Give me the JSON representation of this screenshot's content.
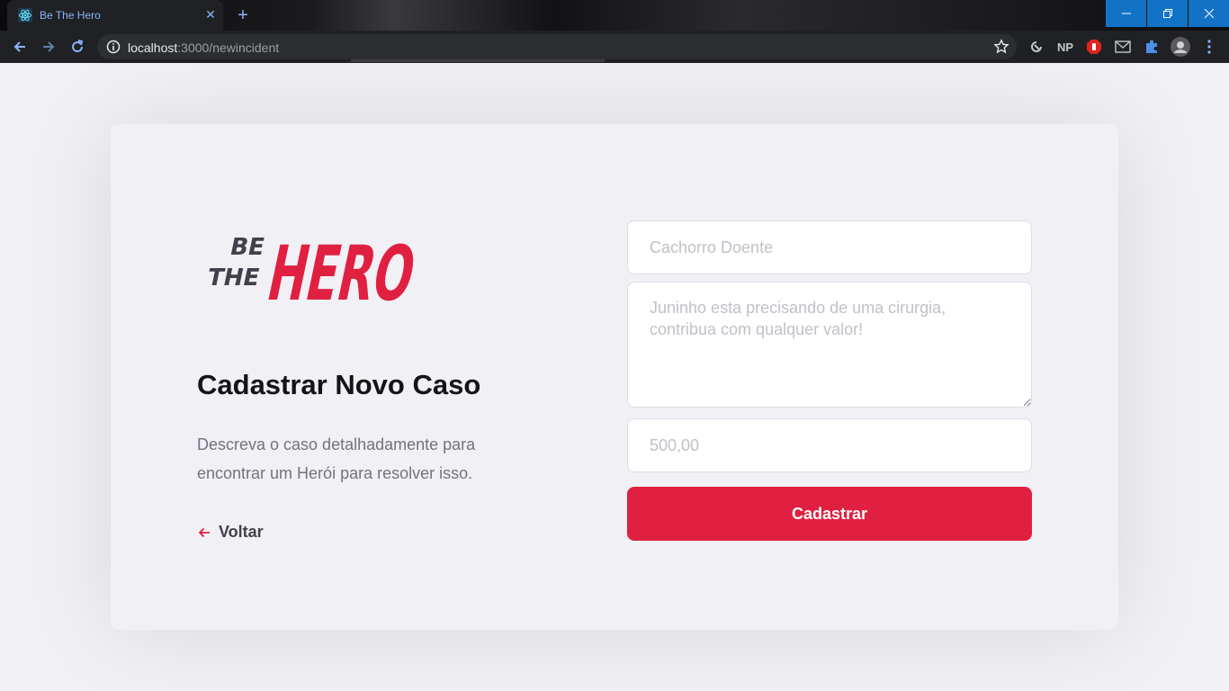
{
  "browser": {
    "tab_title": "Be The Hero",
    "new_tab_label": "+",
    "url_host": "localhost",
    "url_rest": ":3000/newincident",
    "extensions": [
      "NP"
    ]
  },
  "logo": {
    "line1": "BE",
    "line2": "THE",
    "word": "HERO"
  },
  "page": {
    "title": "Cadastrar Novo Caso",
    "description": "Descreva o caso detalhadamente para encontrar um Herói para resolver isso.",
    "back_label": "Voltar"
  },
  "form": {
    "title_placeholder": "Cachorro Doente",
    "description_placeholder": "Juninho esta precisando de uma cirurgia, contribua com qualquer valor!",
    "value_placeholder": "500,00",
    "submit_label": "Cadastrar"
  },
  "colors": {
    "accent": "#e02041",
    "background": "#f0f0f5",
    "heading": "#13131a",
    "text_muted": "#737380"
  }
}
